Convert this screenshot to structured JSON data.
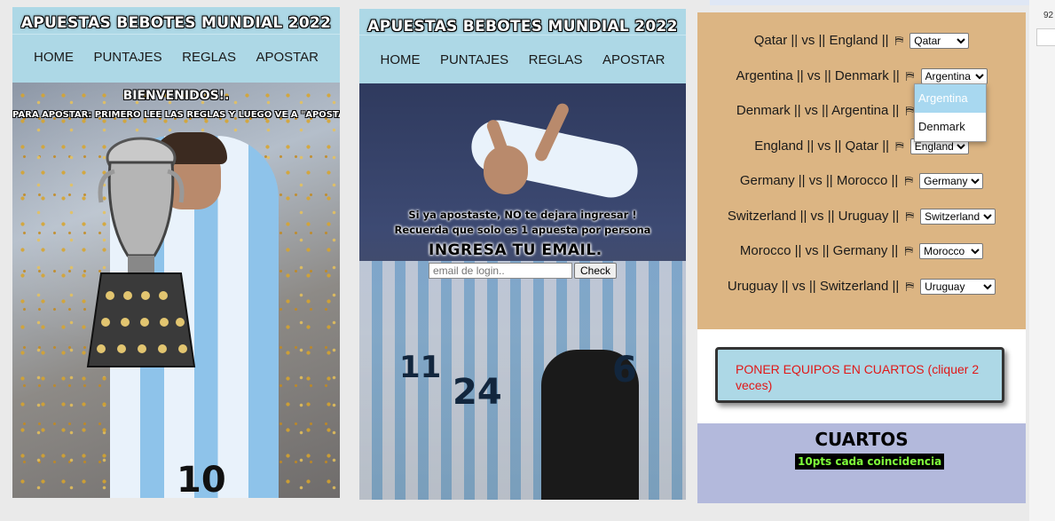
{
  "site": {
    "title": "APUESTAS BEBOTES MUNDIAL 2022",
    "nav": [
      "HOME",
      "PUNTAJES",
      "REGLAS",
      "APOSTAR"
    ]
  },
  "home": {
    "welcome": "BIENVENIDOS!.",
    "instructions": "PARA APOSTAR: PRIMERO LEE LAS REGLAS Y LUEGO VE A \"APOSTAR\"",
    "shirt_number": "10"
  },
  "login": {
    "note_line1": "Si ya apostaste, NO te dejara ingresar !",
    "note_line2": "Recuerda que solo es 1 apuesta por persona",
    "heading": "INGRESA TU EMAIL.",
    "email_placeholder": "email de login..",
    "check_label": "Check",
    "numbers": [
      "11",
      "24",
      "6"
    ]
  },
  "bets": {
    "matches": [
      {
        "label": "Qatar || vs || England ||",
        "selected": "Qatar"
      },
      {
        "label": "Argentina || vs || Denmark ||",
        "selected": "Argentina"
      },
      {
        "label": "Denmark || vs || Argentina ||",
        "selected": ""
      },
      {
        "label": "England || vs || Qatar ||",
        "selected": "England"
      },
      {
        "label": "Germany || vs || Morocco ||",
        "selected": "Germany"
      },
      {
        "label": "Switzerland || vs || Uruguay ||",
        "selected": "Switzerland"
      },
      {
        "label": "Morocco || vs || Germany ||",
        "selected": "Morocco"
      },
      {
        "label": "Uruguay || vs || Switzerland ||",
        "selected": "Uruguay"
      }
    ],
    "flag_glyph": "⛿",
    "open_dropdown": {
      "options": [
        "Argentina",
        "Denmark"
      ],
      "highlighted": "Argentina"
    },
    "quarter_button": "PONER EQUIPOS EN CUARTOS (cliquer 2 veces)",
    "quarters_title": "CUARTOS",
    "points_badge": "10pts cada coincidencia"
  },
  "colors": {
    "header_bg": "#add8e6",
    "bets_bg": "#dcb583",
    "quarters_bg": "#b3b9dc",
    "button_text": "#e01818",
    "badge_text": "#7fff3a"
  },
  "browser": {
    "zoom": "92"
  }
}
